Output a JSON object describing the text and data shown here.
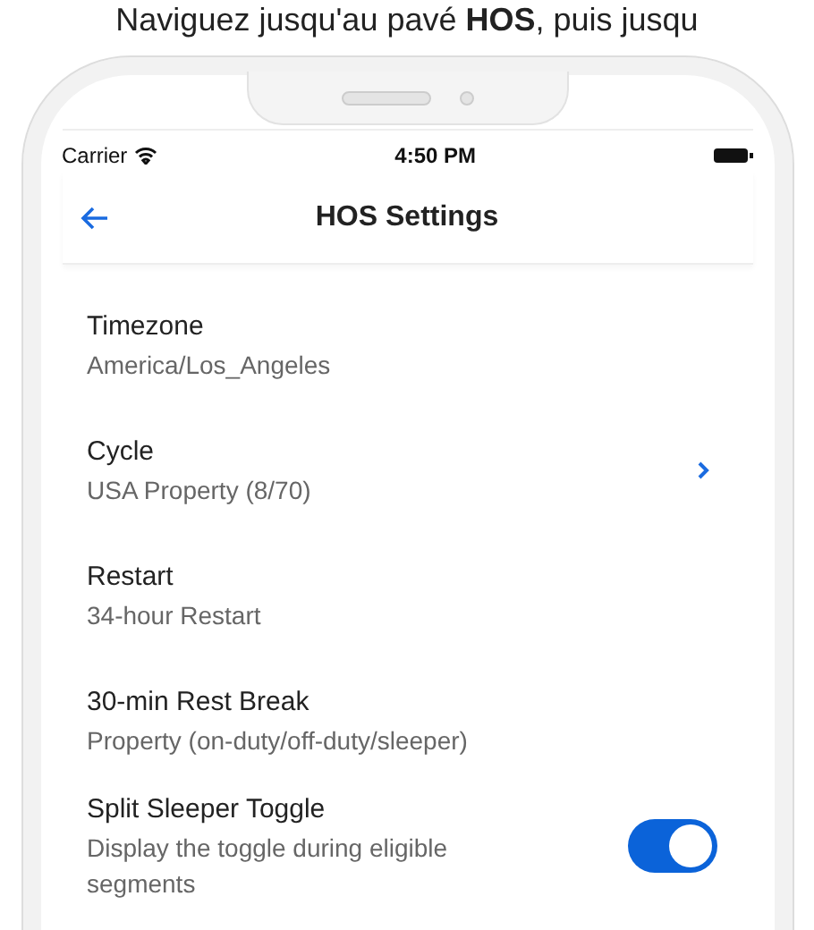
{
  "caption": "Naviguez jusqu'au pavé **HOS**, puis jusqu",
  "status_bar": {
    "carrier": "Carrier",
    "time": "4:50 PM"
  },
  "nav": {
    "title": "HOS Settings"
  },
  "settings": [
    {
      "kind": "text",
      "title": "Timezone",
      "value": "America/Los_Angeles"
    },
    {
      "kind": "link",
      "title": "Cycle",
      "value": "USA Property (8/70)"
    },
    {
      "kind": "text",
      "title": "Restart",
      "value": "34-hour Restart"
    },
    {
      "kind": "text",
      "title": "30-min Rest Break",
      "value": "Property (on-duty/off-duty/sleeper)"
    },
    {
      "kind": "toggle",
      "title": "Split Sleeper Toggle",
      "value": "Display the toggle during eligible segments",
      "on": true
    }
  ]
}
